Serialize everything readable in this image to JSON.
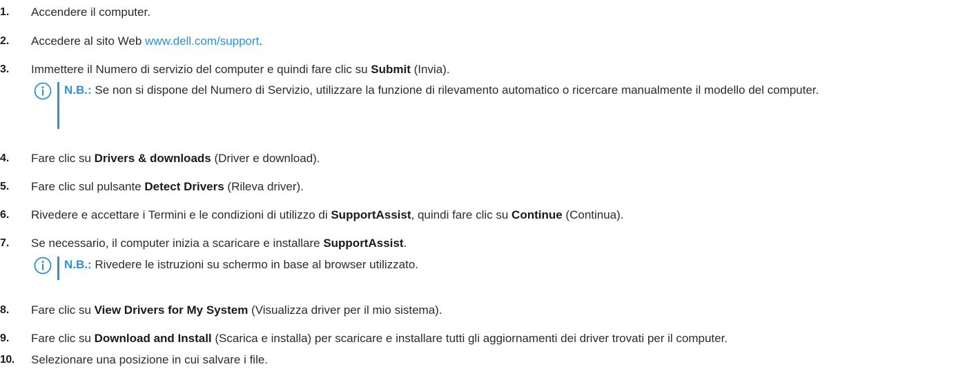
{
  "steps": [
    {
      "num": "1.",
      "parts": {
        "p1": "Accendere il computer."
      }
    },
    {
      "num": "2.",
      "parts": {
        "p1": "Accedere al sito Web ",
        "link": "www.dell.com/support",
        "p2": "."
      }
    },
    {
      "num": "3.",
      "parts": {
        "p1": "Immettere il Numero di servizio del computer e quindi fare clic su ",
        "b1": "Submit",
        "p2": " (Invia)."
      }
    },
    {
      "num": "4.",
      "parts": {
        "p1": "Fare clic su ",
        "b1": "Drivers & downloads",
        "p2": " (Driver e download)."
      }
    },
    {
      "num": "5.",
      "parts": {
        "p1": "Fare clic sul pulsante ",
        "b1": "Detect Drivers",
        "p2": " (Rileva driver)."
      }
    },
    {
      "num": "6.",
      "parts": {
        "p1": "Rivedere e accettare i Termini e le condizioni di utilizzo di ",
        "b1": "SupportAssist",
        "p2": ", quindi fare clic su ",
        "b2": "Continue",
        "p3": " (Continua)."
      }
    },
    {
      "num": "7.",
      "parts": {
        "p1": "Se necessario, il computer inizia a scaricare e installare ",
        "b1": "SupportAssist",
        "p2": "."
      }
    },
    {
      "num": "8.",
      "parts": {
        "p1": "Fare clic su ",
        "b1": "View Drivers for My System",
        "p2": " (Visualizza driver per il mio sistema)."
      }
    },
    {
      "num": "9.",
      "parts": {
        "p1": "Fare clic su ",
        "b1": "Download and Install",
        "p2": " (Scarica e installa) per scaricare e installare tutti gli aggiornamenti dei driver trovati per il computer."
      }
    },
    {
      "num": "10.",
      "parts": {
        "p1": "Selezionare una posizione in cui salvare i file."
      }
    }
  ],
  "notes": [
    {
      "label": "N.B.:",
      "text": " Se non si dispone del Numero di Servizio, utilizzare la funzione di rilevamento automatico o ricercare manualmente il modello del computer."
    },
    {
      "label": "N.B.:",
      "text": " Rivedere le istruzioni su schermo in base al browser utilizzato."
    }
  ],
  "icon": "info-icon",
  "colors": {
    "accent": "#2f8fd3",
    "text": "#2b2b2b"
  }
}
